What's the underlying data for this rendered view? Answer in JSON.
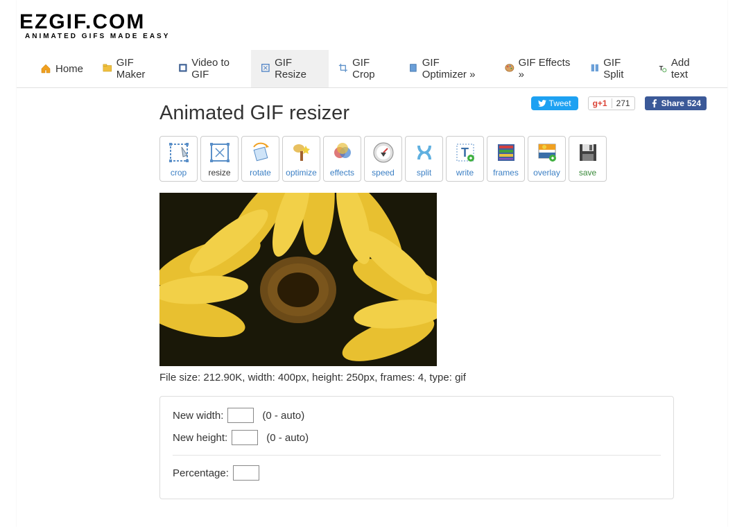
{
  "brand": {
    "name": "EZGIF.COM",
    "tagline": "ANIMATED GIFS MADE EASY"
  },
  "nav": {
    "home": "Home",
    "gifmaker": "GIF Maker",
    "videotogif": "Video to GIF",
    "gifresize": "GIF Resize",
    "gifcrop": "GIF Crop",
    "gifoptimizer": "GIF Optimizer »",
    "gifeffects": "GIF Effects »",
    "gifsplit": "GIF Split",
    "addtext": "Add text"
  },
  "social": {
    "tweet": "Tweet",
    "gplus_count": "271",
    "fbshare": "Share",
    "fbshare_count": "524"
  },
  "page_title": "Animated GIF resizer",
  "tools": {
    "crop": "crop",
    "resize": "resize",
    "rotate": "rotate",
    "optimize": "optimize",
    "effects": "effects",
    "speed": "speed",
    "split": "split",
    "write": "write",
    "frames": "frames",
    "overlay": "overlay",
    "save": "save"
  },
  "fileinfo": "File size: 212.90K, width: 400px, height: 250px, frames: 4, type: gif",
  "form": {
    "new_width_label": "New width:",
    "new_width_value": "",
    "new_height_label": "New height:",
    "new_height_value": "",
    "auto_hint": "(0 - auto)",
    "percentage_label": "Percentage:",
    "percentage_value": ""
  }
}
